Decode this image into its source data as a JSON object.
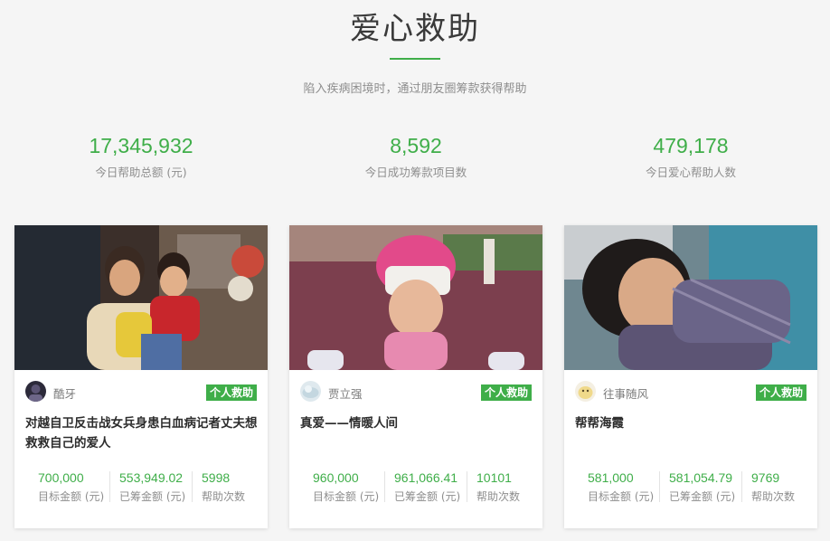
{
  "header": {
    "title": "爱心救助",
    "subtitle": "陷入疾病困境时，通过朋友圈筹款获得帮助"
  },
  "stats": [
    {
      "value": "17,345,932",
      "label": "今日帮助总额 (元)"
    },
    {
      "value": "8,592",
      "label": "今日成功筹款项目数"
    },
    {
      "value": "479,178",
      "label": "今日爱心帮助人数"
    }
  ],
  "cards": [
    {
      "author": "酷牙",
      "badge": "个人救助",
      "title": "对越自卫反击战女兵身患白血病记者丈夫想救救自己的爱人",
      "metrics": [
        {
          "value": "700,000",
          "label": "目标金额 (元)"
        },
        {
          "value": "553,949.02",
          "label": "已筹金额 (元)"
        },
        {
          "value": "5998",
          "label": "帮助次数"
        }
      ]
    },
    {
      "author": "贾立强",
      "badge": "个人救助",
      "title": "真爱——情暖人间",
      "metrics": [
        {
          "value": "960,000",
          "label": "目标金额 (元)"
        },
        {
          "value": "961,066.41",
          "label": "已筹金额 (元)"
        },
        {
          "value": "10101",
          "label": "帮助次数"
        }
      ]
    },
    {
      "author": "往事随风",
      "badge": "个人救助",
      "title": "帮帮海霞",
      "metrics": [
        {
          "value": "581,000",
          "label": "目标金额 (元)"
        },
        {
          "value": "581,054.79",
          "label": "已筹金额 (元)"
        },
        {
          "value": "9769",
          "label": "帮助次数"
        }
      ]
    }
  ],
  "colors": {
    "accent": "#3fae49",
    "background": "#f5f5f5",
    "muted_text": "#8e8e8e"
  }
}
